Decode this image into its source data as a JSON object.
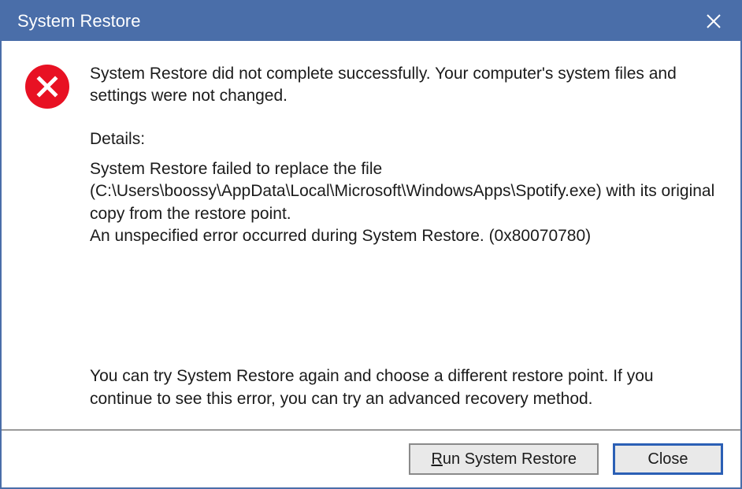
{
  "window": {
    "title": "System Restore"
  },
  "icon": {
    "name": "error"
  },
  "message": {
    "summary": "System Restore did not complete successfully. Your computer's system files and settings were not changed.",
    "details_label": "Details:",
    "details_body": "System Restore failed to replace the file (C:\\Users\\boossy\\AppData\\Local\\Microsoft\\WindowsApps\\Spotify.exe) with its original copy from the restore point.\nAn unspecified error occurred during System Restore. (0x80070780)",
    "suggestion": "You can try System Restore again and choose a different restore point. If you continue to see this error, you can try an advanced recovery method."
  },
  "buttons": {
    "run": {
      "mnemonic": "R",
      "rest": "un System Restore"
    },
    "close": {
      "label": "Close"
    }
  }
}
